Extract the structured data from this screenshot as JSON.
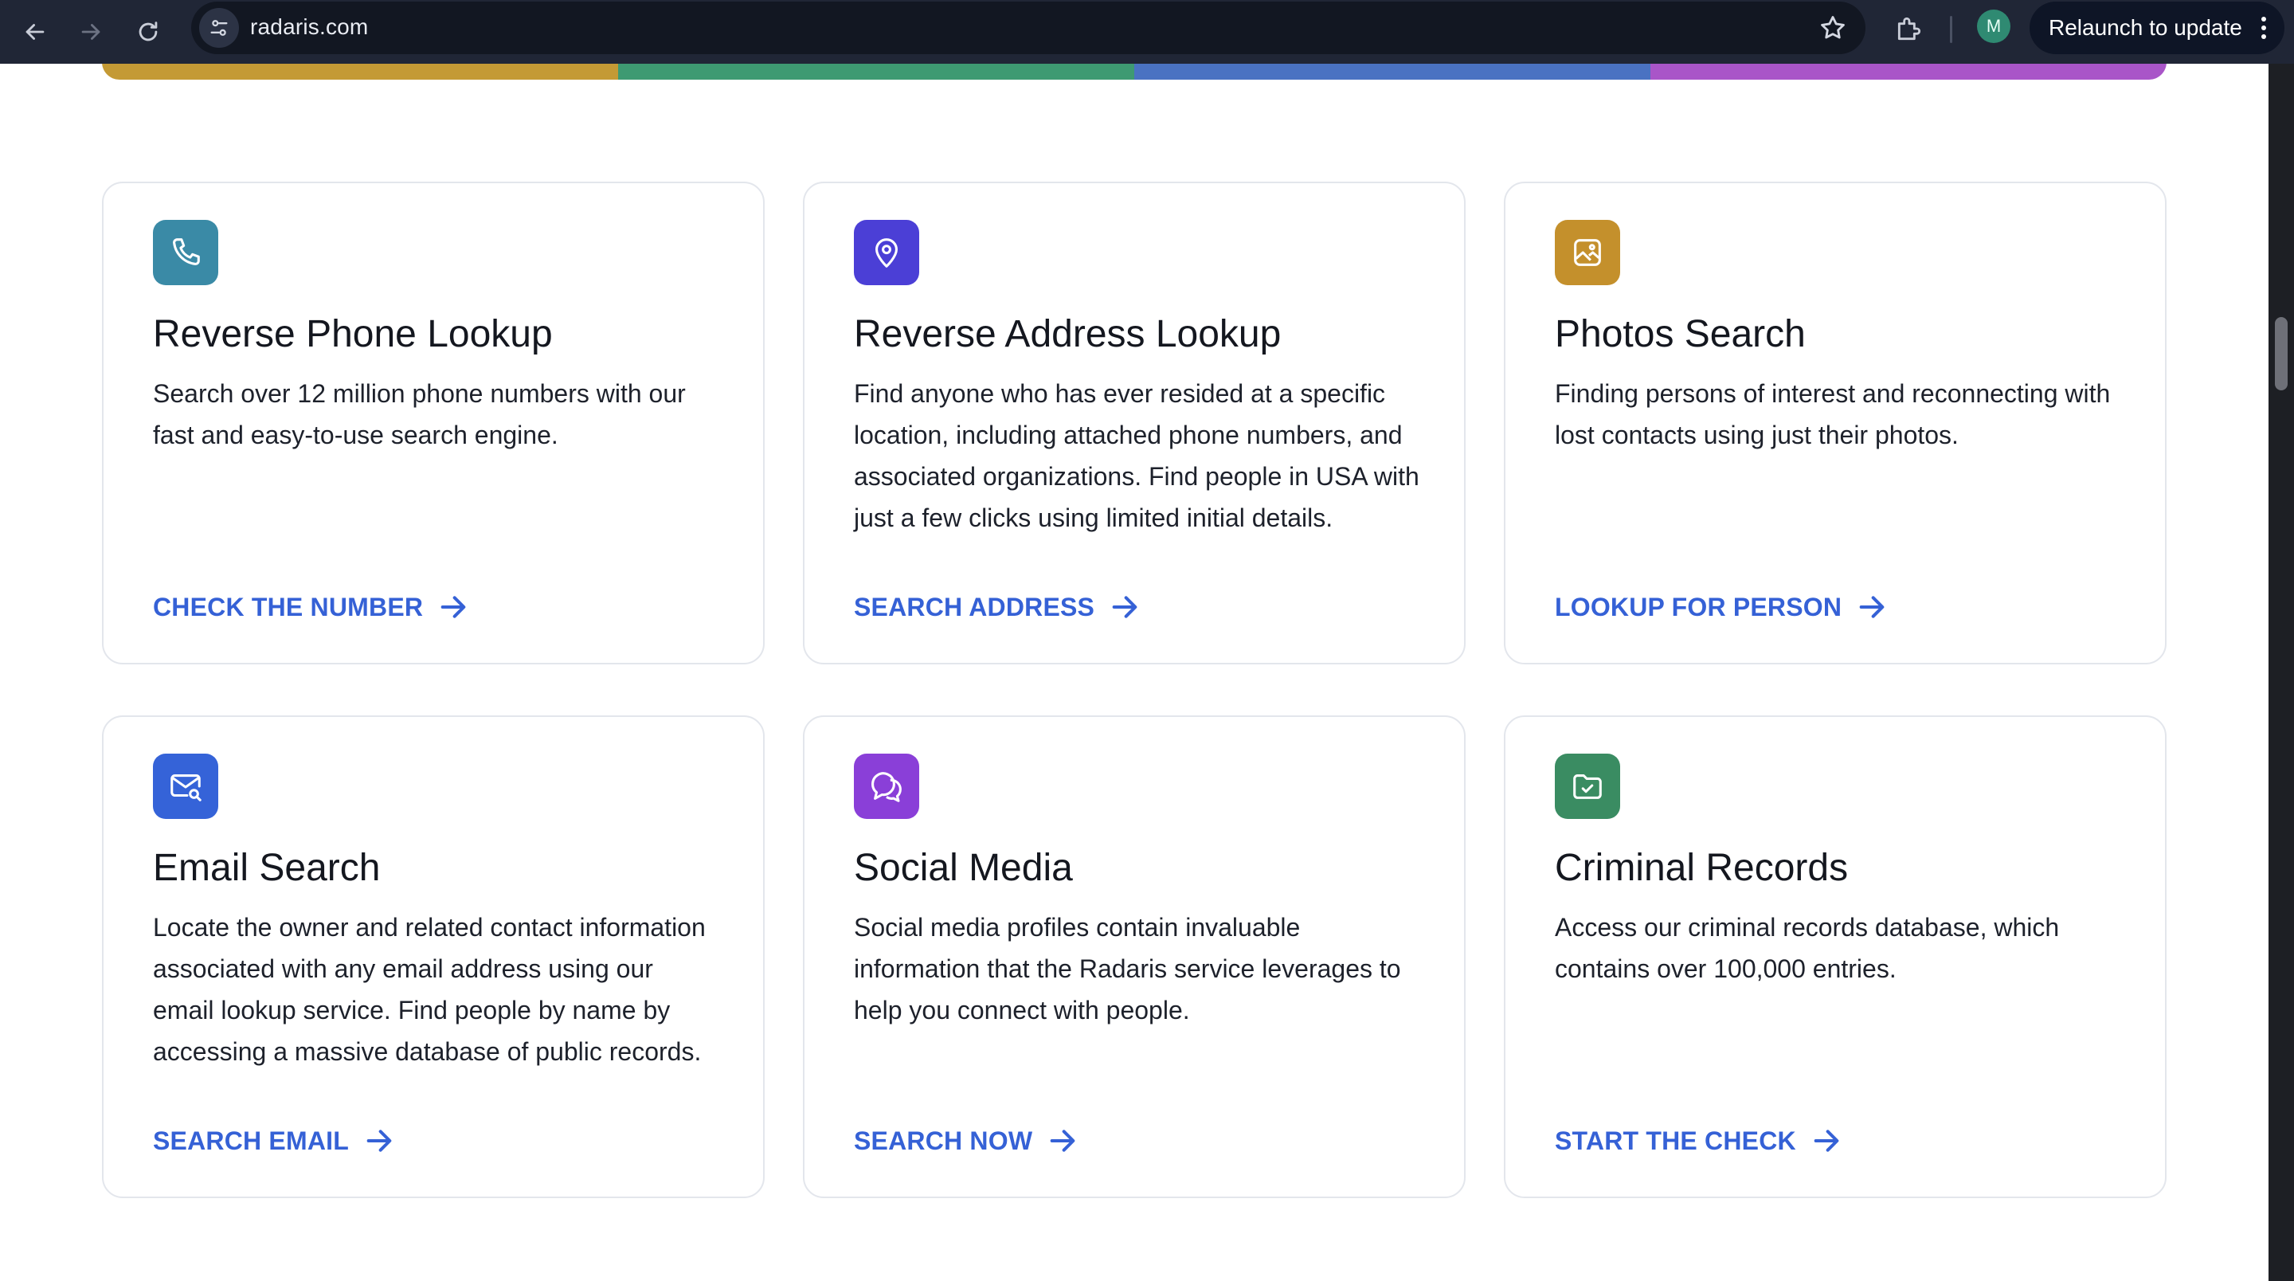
{
  "browser": {
    "url": "radaris.com",
    "profile_initial": "M",
    "relaunch_label": "Relaunch to update",
    "icons": {
      "back": "arrow-left-icon",
      "forward": "arrow-right-icon",
      "reload": "reload-icon",
      "site_info": "tune-icon",
      "bookmark": "star-icon",
      "extensions": "puzzle-icon",
      "menu": "kebab-menu-icon"
    }
  },
  "accent_strip": [
    "#c49a35",
    "#3e9a72",
    "#4a72c2",
    "#a955c8"
  ],
  "cards": [
    {
      "title": "Reverse Phone Lookup",
      "description": "Search over 12 million phone numbers with our fast and easy-to-use search engine.",
      "cta": "CHECK THE NUMBER",
      "icon": "phone-icon",
      "icon_color": "#3a8aa6"
    },
    {
      "title": "Reverse Address Lookup",
      "description": "Find anyone who has ever resided at a specific location, including attached phone numbers, and associated organizations. Find people in USA with just a few clicks using limited initial details.",
      "cta": "SEARCH ADDRESS",
      "icon": "location-pin-icon",
      "icon_color": "#4b3fd6"
    },
    {
      "title": "Photos Search",
      "description": "Finding persons of interest and reconnecting with lost contacts using just their photos.",
      "cta": "LOOKUP FOR PERSON",
      "icon": "image-icon",
      "icon_color": "#c4902c"
    },
    {
      "title": "Email Search",
      "description": "Locate the owner and related contact information associated with any email address using our email lookup service. Find people by name by accessing a massive database of public records.",
      "cta": "SEARCH EMAIL",
      "icon": "mail-search-icon",
      "icon_color": "#3563d8"
    },
    {
      "title": "Social Media",
      "description": "Social media profiles contain invaluable information that the Radaris service leverages to help you connect with people.",
      "cta": "SEARCH NOW",
      "icon": "chat-bubbles-icon",
      "icon_color": "#8a3fd8"
    },
    {
      "title": "Criminal Records",
      "description": "Access our criminal records database, which contains over 100,000 entries.",
      "cta": "START THE CHECK",
      "icon": "folder-check-icon",
      "icon_color": "#3a8c62"
    }
  ],
  "cta_color": "#3561d6"
}
